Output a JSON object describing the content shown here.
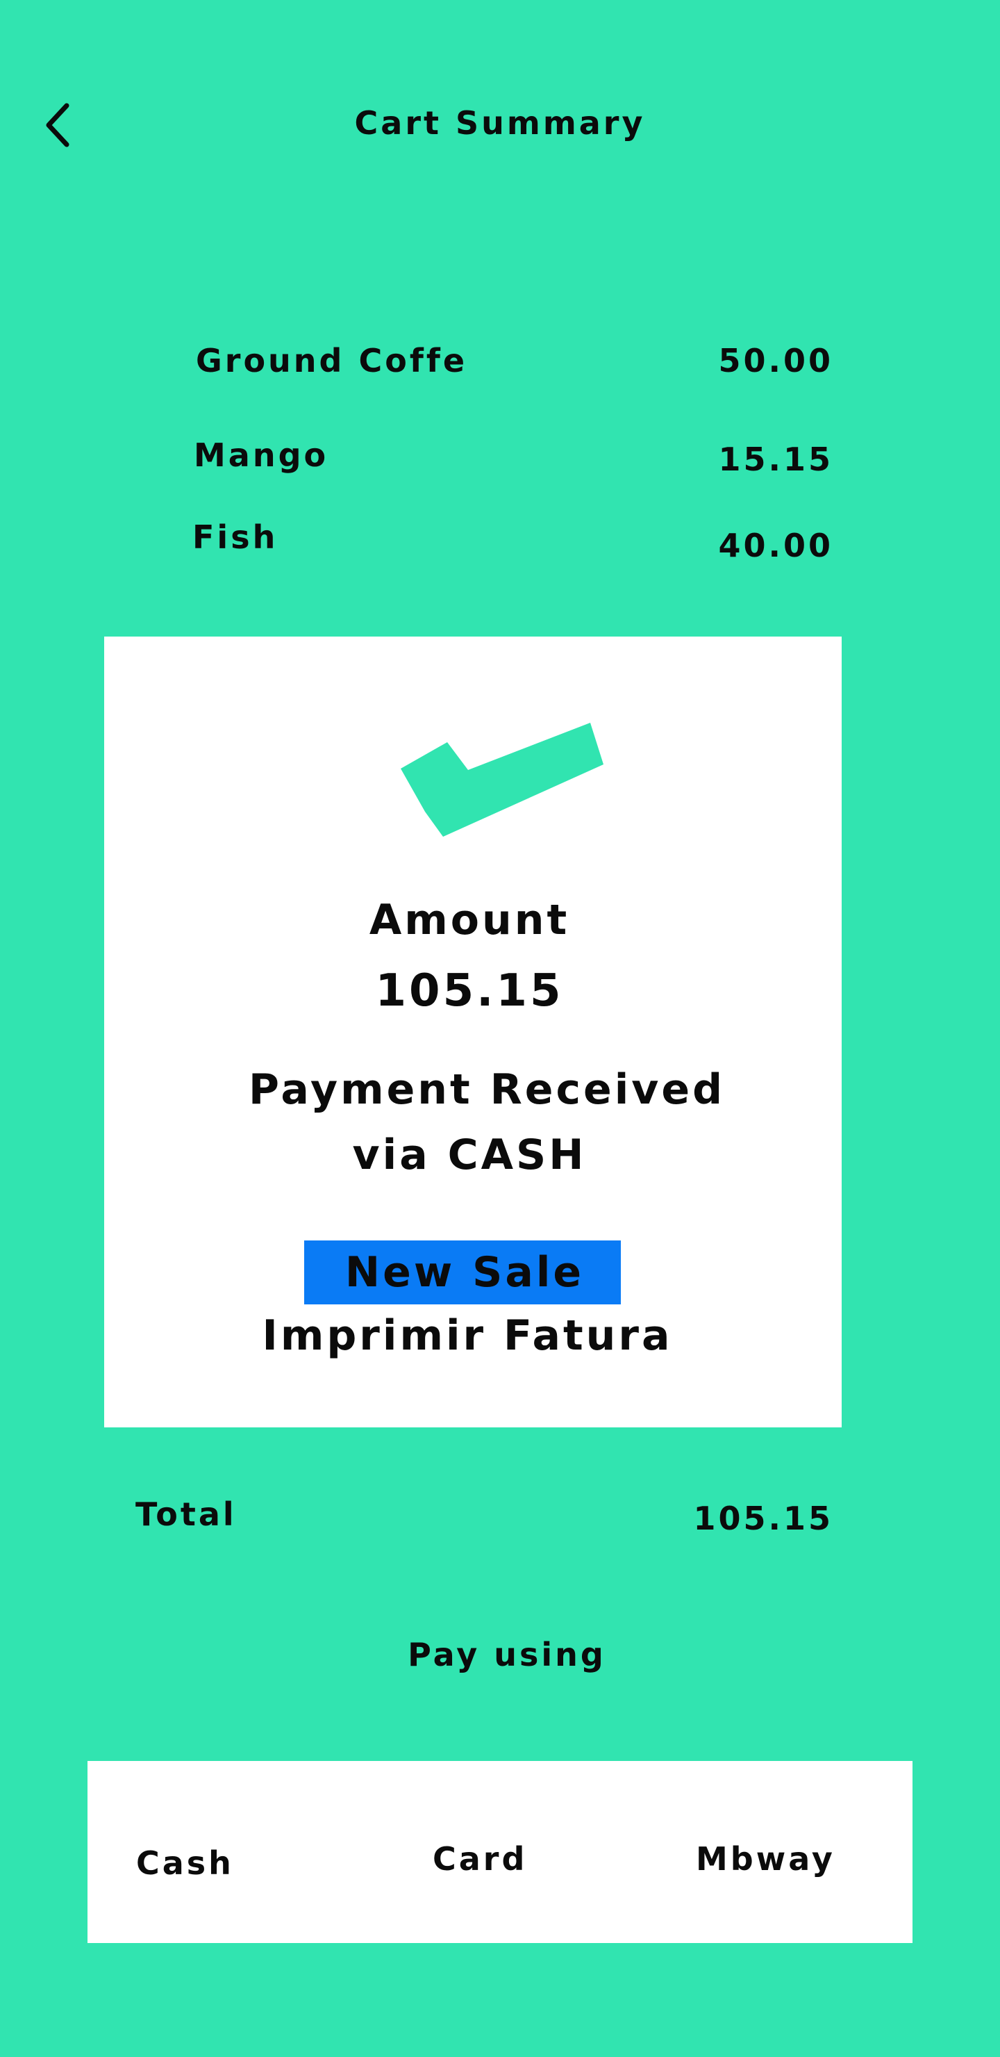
{
  "header": {
    "title": "Cart Summary",
    "back_icon": "chevron-left-icon"
  },
  "cart": {
    "items": [
      {
        "name": "Ground Coffe",
        "price": "50.00"
      },
      {
        "name": "Mango",
        "price": "15.15"
      },
      {
        "name": "Fish",
        "price": "40.00"
      }
    ]
  },
  "receipt": {
    "status_icon": "checkmark-icon",
    "amount_label": "Amount",
    "amount_value": "105.15",
    "payment_line1": "Payment Received",
    "payment_line2": "via CASH",
    "new_sale_label": "New Sale",
    "print_label": "Imprimir Fatura"
  },
  "summary": {
    "total_label": "Total",
    "total_value": "105.15"
  },
  "payment": {
    "title": "Pay using",
    "options": [
      "Cash",
      "Card",
      "Mbway"
    ]
  },
  "colors": {
    "background": "#31E4B0",
    "card": "#FFFFFF",
    "accent_button": "#0A7BF5",
    "check_icon": "#31E4B0",
    "text": "#0B0B0B"
  }
}
